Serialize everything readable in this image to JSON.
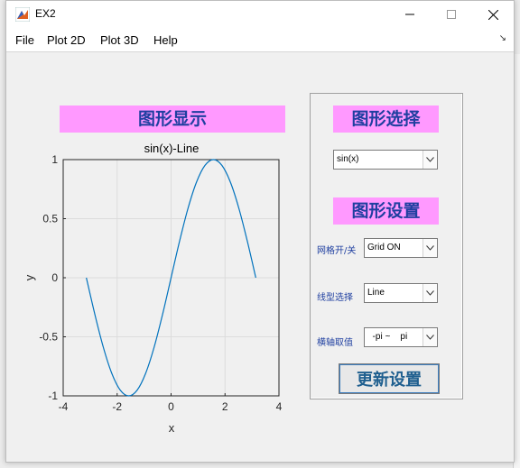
{
  "window": {
    "title": "EX2"
  },
  "menu": {
    "items": [
      {
        "label": "File"
      },
      {
        "label": "Plot 2D"
      },
      {
        "label": "Plot 3D"
      },
      {
        "label": "Help"
      }
    ]
  },
  "left": {
    "header": "图形显示"
  },
  "chart_data": {
    "type": "line",
    "title": "sin(x)-Line",
    "xlabel": "x",
    "ylabel": "y",
    "xlim": [
      -4,
      4
    ],
    "ylim": [
      -1,
      1
    ],
    "xticks": [
      "-4",
      "-2",
      "0",
      "2",
      "4"
    ],
    "yticks": [
      "1",
      "0.5",
      "0",
      "-0.5",
      "-1"
    ],
    "grid": true,
    "series": [
      {
        "color": "#0072bd",
        "x": [
          -3.1416,
          -2.8274,
          -2.5133,
          -2.1991,
          -1.885,
          -1.5708,
          -1.2566,
          -0.9425,
          -0.6283,
          -0.3142,
          0,
          0.3142,
          0.6283,
          0.9425,
          1.2566,
          1.5708,
          1.885,
          2.1991,
          2.5133,
          2.8274,
          3.1416
        ],
        "y": [
          0,
          -0.309,
          -0.5878,
          -0.809,
          -0.9511,
          -1,
          -0.9511,
          -0.809,
          -0.5878,
          -0.309,
          0,
          0.309,
          0.5878,
          0.809,
          0.9511,
          1,
          0.9511,
          0.809,
          0.5878,
          0.309,
          0
        ]
      }
    ]
  },
  "panel": {
    "select_header": "图形选择",
    "function_dropdown": "sin(x)",
    "settings_header": "图形设置",
    "grid_label": "网格开/关",
    "grid_dropdown": "Grid ON",
    "linetype_label": "线型选择",
    "linetype_dropdown": "Line",
    "range_label": "横轴取值",
    "range_dropdown": "  -pi ~    pi",
    "update_button": "更新设置"
  },
  "colors": {
    "label_bg": "#ff99ff",
    "label_text": "#1f3fa0",
    "line": "#0072bd"
  }
}
